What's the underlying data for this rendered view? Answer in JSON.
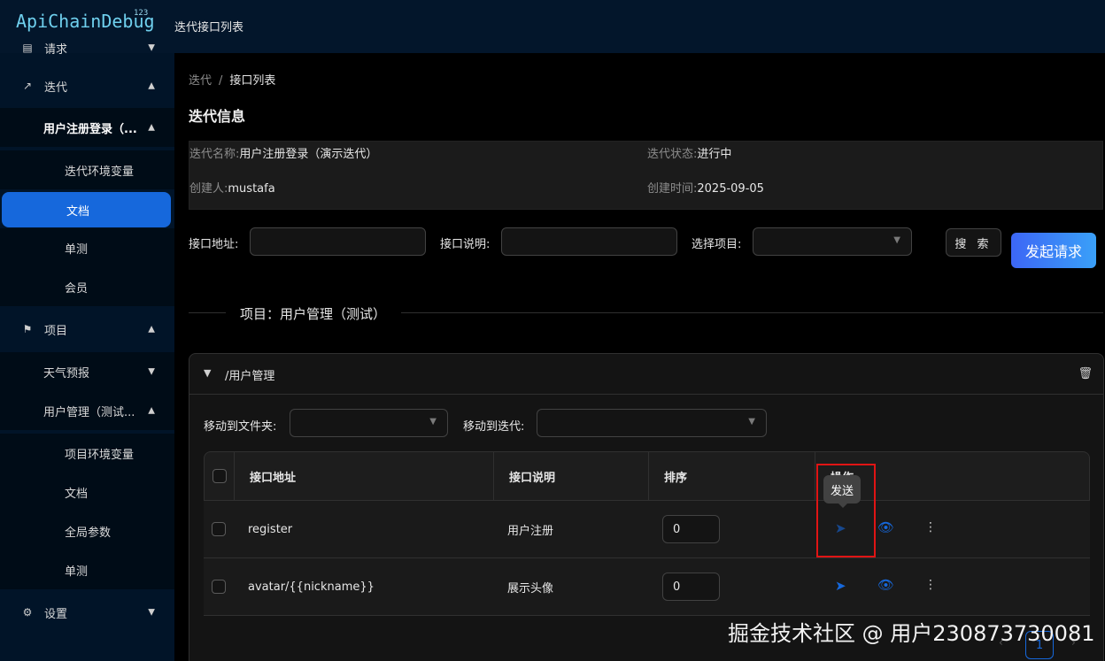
{
  "app": {
    "logo": "ApiChainDebug",
    "logo_sup": "123",
    "header_title": "迭代接口列表"
  },
  "sidebar": {
    "items": [
      {
        "label": "请求",
        "level": 1,
        "icon": "calendar-icon",
        "arrow": "down"
      },
      {
        "label": "迭代",
        "level": 1,
        "icon": "chart-line-icon",
        "arrow": "up"
      },
      {
        "label": "用户注册登录（...",
        "level": 2,
        "arrow": "up"
      },
      {
        "label": "迭代环境变量",
        "level": 3
      },
      {
        "label": "文档",
        "level": 3,
        "active": true
      },
      {
        "label": "单测",
        "level": 3
      },
      {
        "label": "会员",
        "level": 3
      },
      {
        "label": "项目",
        "level": 1,
        "icon": "flag-icon",
        "arrow": "up"
      },
      {
        "label": "天气预报",
        "level": 2,
        "arrow": "down"
      },
      {
        "label": "用户管理（测试...",
        "level": 2,
        "arrow": "up"
      },
      {
        "label": "项目环境变量",
        "level": 3
      },
      {
        "label": "文档",
        "level": 3
      },
      {
        "label": "全局参数",
        "level": 3
      },
      {
        "label": "单测",
        "level": 3
      },
      {
        "label": "设置",
        "level": 1,
        "icon": "gear-icon",
        "arrow": "down"
      }
    ]
  },
  "breadcrumb": {
    "parent": "迭代",
    "separator": "/",
    "current": "接口列表"
  },
  "section_title": "迭代信息",
  "iteration": {
    "name_key": "迭代名称:",
    "name_val": "用户注册登录（演示迭代）",
    "status_key": "迭代状态:",
    "status_val": "进行中",
    "creator_key": "创建人:",
    "creator_val": "mustafa",
    "created_key": "创建时间:",
    "created_val": "2025-09-05"
  },
  "filters": {
    "url_label": "接口地址:",
    "desc_label": "接口说明:",
    "project_label": "选择项目:",
    "search_btn": "搜 索",
    "request_btn": "发起请求"
  },
  "divider_text": "项目：用户管理（测试）",
  "folder": {
    "title": "/用户管理",
    "move_folder_label": "移动到文件夹:",
    "move_iter_label": "移动到迭代:"
  },
  "table": {
    "columns": [
      "接口地址",
      "接口说明",
      "排序",
      "操作"
    ],
    "rows": [
      {
        "url": "register",
        "desc": "用户注册",
        "order": "0"
      },
      {
        "url": "avatar/{{nickname}}",
        "desc": "展示头像",
        "order": "0"
      }
    ]
  },
  "tooltip": "发送",
  "pagination": {
    "current": "1"
  },
  "watermark": "掘金技术社区 @ 用户230873730081",
  "colors": {
    "primary": "#1668dc",
    "sidebar": "#011428",
    "header": "#03162b",
    "highlight": "#e01414"
  }
}
